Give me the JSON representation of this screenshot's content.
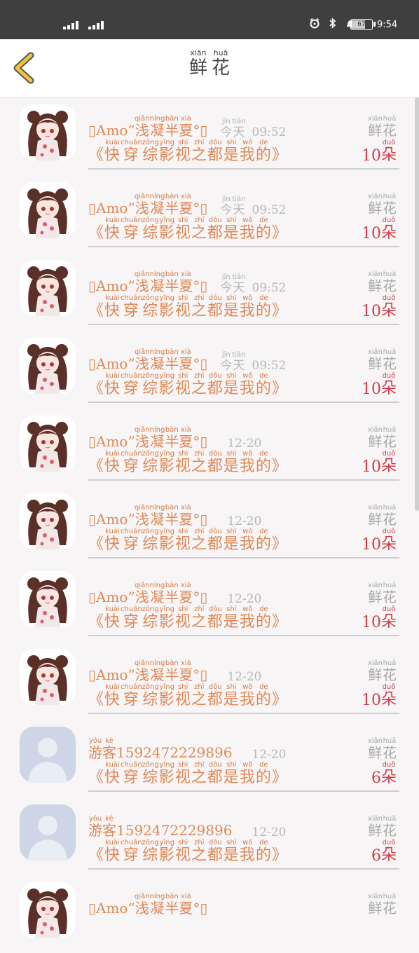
{
  "status_bar": {
    "time": "9:54",
    "battery": "67",
    "battery_level": 0.67
  },
  "header": {
    "title": [
      {
        "char": "鲜",
        "pinyin": "xiān"
      },
      {
        "char": "花",
        "pinyin": "huā"
      }
    ]
  },
  "rows": [
    {
      "avatar": "anime-girl",
      "name_prefix": "Amo",
      "name_mid": "”",
      "name_chars": [
        {
          "c": "浅",
          "p": "qiǎn"
        },
        {
          "c": "凝",
          "p": "níng"
        },
        {
          "c": "半",
          "p": "bàn"
        },
        {
          "c": "夏",
          "p": "xià"
        }
      ],
      "name_suffix": "°",
      "time_chars": [
        {
          "c": "今",
          "p": "jīn"
        },
        {
          "c": "天",
          "p": "tiān"
        }
      ],
      "time": "09:52",
      "book_open": "《",
      "book_chars": [
        {
          "c": "快",
          "p": "kuài"
        },
        {
          "c": "穿",
          "p": "chuān"
        },
        {
          "c": "综",
          "p": "zōng"
        },
        {
          "c": "影",
          "p": "yǐng"
        },
        {
          "c": "视",
          "p": "shì"
        },
        {
          "c": "之",
          "p": "zhī"
        },
        {
          "c": "都",
          "p": "dōu"
        },
        {
          "c": "是",
          "p": "shì"
        },
        {
          "c": "我",
          "p": "wǒ"
        },
        {
          "c": "的",
          "p": "de"
        }
      ],
      "book_close": "》",
      "gift": [
        {
          "c": "鲜",
          "p": "xiān"
        },
        {
          "c": "花",
          "p": "huā"
        }
      ],
      "count": "10",
      "unit": {
        "c": "朵",
        "p": "duǒ"
      }
    },
    {
      "avatar": "anime-girl",
      "name_prefix": "Amo",
      "name_mid": "”",
      "name_chars": [
        {
          "c": "浅",
          "p": "qiǎn"
        },
        {
          "c": "凝",
          "p": "níng"
        },
        {
          "c": "半",
          "p": "bàn"
        },
        {
          "c": "夏",
          "p": "xià"
        }
      ],
      "name_suffix": "°",
      "time_chars": [
        {
          "c": "今",
          "p": "jīn"
        },
        {
          "c": "天",
          "p": "tiān"
        }
      ],
      "time": "09:52",
      "book_open": "《",
      "book_chars": [
        {
          "c": "快",
          "p": "kuài"
        },
        {
          "c": "穿",
          "p": "chuān"
        },
        {
          "c": "综",
          "p": "zōng"
        },
        {
          "c": "影",
          "p": "yǐng"
        },
        {
          "c": "视",
          "p": "shì"
        },
        {
          "c": "之",
          "p": "zhī"
        },
        {
          "c": "都",
          "p": "dōu"
        },
        {
          "c": "是",
          "p": "shì"
        },
        {
          "c": "我",
          "p": "wǒ"
        },
        {
          "c": "的",
          "p": "de"
        }
      ],
      "book_close": "》",
      "gift": [
        {
          "c": "鲜",
          "p": "xiān"
        },
        {
          "c": "花",
          "p": "huā"
        }
      ],
      "count": "10",
      "unit": {
        "c": "朵",
        "p": "duǒ"
      }
    },
    {
      "avatar": "anime-girl",
      "name_prefix": "Amo",
      "name_mid": "”",
      "name_chars": [
        {
          "c": "浅",
          "p": "qiǎn"
        },
        {
          "c": "凝",
          "p": "níng"
        },
        {
          "c": "半",
          "p": "bàn"
        },
        {
          "c": "夏",
          "p": "xià"
        }
      ],
      "name_suffix": "°",
      "time_chars": [
        {
          "c": "今",
          "p": "jīn"
        },
        {
          "c": "天",
          "p": "tiān"
        }
      ],
      "time": "09:52",
      "book_open": "《",
      "book_chars": [
        {
          "c": "快",
          "p": "kuài"
        },
        {
          "c": "穿",
          "p": "chuān"
        },
        {
          "c": "综",
          "p": "zōng"
        },
        {
          "c": "影",
          "p": "yǐng"
        },
        {
          "c": "视",
          "p": "shì"
        },
        {
          "c": "之",
          "p": "zhī"
        },
        {
          "c": "都",
          "p": "dōu"
        },
        {
          "c": "是",
          "p": "shì"
        },
        {
          "c": "我",
          "p": "wǒ"
        },
        {
          "c": "的",
          "p": "de"
        }
      ],
      "book_close": "》",
      "gift": [
        {
          "c": "鲜",
          "p": "xiān"
        },
        {
          "c": "花",
          "p": "huā"
        }
      ],
      "count": "10",
      "unit": {
        "c": "朵",
        "p": "duǒ"
      }
    },
    {
      "avatar": "anime-girl",
      "name_prefix": "Amo",
      "name_mid": "”",
      "name_chars": [
        {
          "c": "浅",
          "p": "qiǎn"
        },
        {
          "c": "凝",
          "p": "níng"
        },
        {
          "c": "半",
          "p": "bàn"
        },
        {
          "c": "夏",
          "p": "xià"
        }
      ],
      "name_suffix": "°",
      "time_chars": [
        {
          "c": "今",
          "p": "jīn"
        },
        {
          "c": "天",
          "p": "tiān"
        }
      ],
      "time": "09:52",
      "book_open": "《",
      "book_chars": [
        {
          "c": "快",
          "p": "kuài"
        },
        {
          "c": "穿",
          "p": "chuān"
        },
        {
          "c": "综",
          "p": "zōng"
        },
        {
          "c": "影",
          "p": "yǐng"
        },
        {
          "c": "视",
          "p": "shì"
        },
        {
          "c": "之",
          "p": "zhī"
        },
        {
          "c": "都",
          "p": "dōu"
        },
        {
          "c": "是",
          "p": "shì"
        },
        {
          "c": "我",
          "p": "wǒ"
        },
        {
          "c": "的",
          "p": "de"
        }
      ],
      "book_close": "》",
      "gift": [
        {
          "c": "鲜",
          "p": "xiān"
        },
        {
          "c": "花",
          "p": "huā"
        }
      ],
      "count": "10",
      "unit": {
        "c": "朵",
        "p": "duǒ"
      }
    },
    {
      "avatar": "anime-girl",
      "name_prefix": "Amo",
      "name_mid": "”",
      "name_chars": [
        {
          "c": "浅",
          "p": "qiǎn"
        },
        {
          "c": "凝",
          "p": "níng"
        },
        {
          "c": "半",
          "p": "bàn"
        },
        {
          "c": "夏",
          "p": "xià"
        }
      ],
      "name_suffix": "°",
      "time_chars": [],
      "time": "12-20",
      "book_open": "《",
      "book_chars": [
        {
          "c": "快",
          "p": "kuài"
        },
        {
          "c": "穿",
          "p": "chuān"
        },
        {
          "c": "综",
          "p": "zōng"
        },
        {
          "c": "影",
          "p": "yǐng"
        },
        {
          "c": "视",
          "p": "shì"
        },
        {
          "c": "之",
          "p": "zhī"
        },
        {
          "c": "都",
          "p": "dōu"
        },
        {
          "c": "是",
          "p": "shì"
        },
        {
          "c": "我",
          "p": "wǒ"
        },
        {
          "c": "的",
          "p": "de"
        }
      ],
      "book_close": "》",
      "gift": [
        {
          "c": "鲜",
          "p": "xiān"
        },
        {
          "c": "花",
          "p": "huā"
        }
      ],
      "count": "10",
      "unit": {
        "c": "朵",
        "p": "duǒ"
      }
    },
    {
      "avatar": "anime-girl",
      "name_prefix": "Amo",
      "name_mid": "”",
      "name_chars": [
        {
          "c": "浅",
          "p": "qiǎn"
        },
        {
          "c": "凝",
          "p": "níng"
        },
        {
          "c": "半",
          "p": "bàn"
        },
        {
          "c": "夏",
          "p": "xià"
        }
      ],
      "name_suffix": "°",
      "time_chars": [],
      "time": "12-20",
      "book_open": "《",
      "book_chars": [
        {
          "c": "快",
          "p": "kuài"
        },
        {
          "c": "穿",
          "p": "chuān"
        },
        {
          "c": "综",
          "p": "zōng"
        },
        {
          "c": "影",
          "p": "yǐng"
        },
        {
          "c": "视",
          "p": "shì"
        },
        {
          "c": "之",
          "p": "zhī"
        },
        {
          "c": "都",
          "p": "dōu"
        },
        {
          "c": "是",
          "p": "shì"
        },
        {
          "c": "我",
          "p": "wǒ"
        },
        {
          "c": "的",
          "p": "de"
        }
      ],
      "book_close": "》",
      "gift": [
        {
          "c": "鲜",
          "p": "xiān"
        },
        {
          "c": "花",
          "p": "huā"
        }
      ],
      "count": "10",
      "unit": {
        "c": "朵",
        "p": "duǒ"
      }
    },
    {
      "avatar": "anime-girl",
      "name_prefix": "Amo",
      "name_mid": "”",
      "name_chars": [
        {
          "c": "浅",
          "p": "qiǎn"
        },
        {
          "c": "凝",
          "p": "níng"
        },
        {
          "c": "半",
          "p": "bàn"
        },
        {
          "c": "夏",
          "p": "xià"
        }
      ],
      "name_suffix": "°",
      "time_chars": [],
      "time": "12-20",
      "book_open": "《",
      "book_chars": [
        {
          "c": "快",
          "p": "kuài"
        },
        {
          "c": "穿",
          "p": "chuān"
        },
        {
          "c": "综",
          "p": "zōng"
        },
        {
          "c": "影",
          "p": "yǐng"
        },
        {
          "c": "视",
          "p": "shì"
        },
        {
          "c": "之",
          "p": "zhī"
        },
        {
          "c": "都",
          "p": "dōu"
        },
        {
          "c": "是",
          "p": "shì"
        },
        {
          "c": "我",
          "p": "wǒ"
        },
        {
          "c": "的",
          "p": "de"
        }
      ],
      "book_close": "》",
      "gift": [
        {
          "c": "鲜",
          "p": "xiān"
        },
        {
          "c": "花",
          "p": "huā"
        }
      ],
      "count": "10",
      "unit": {
        "c": "朵",
        "p": "duǒ"
      }
    },
    {
      "avatar": "anime-girl",
      "name_prefix": "Amo",
      "name_mid": "”",
      "name_chars": [
        {
          "c": "浅",
          "p": "qiǎn"
        },
        {
          "c": "凝",
          "p": "níng"
        },
        {
          "c": "半",
          "p": "bàn"
        },
        {
          "c": "夏",
          "p": "xià"
        }
      ],
      "name_suffix": "°",
      "time_chars": [],
      "time": "12-20",
      "book_open": "《",
      "book_chars": [
        {
          "c": "快",
          "p": "kuài"
        },
        {
          "c": "穿",
          "p": "chuān"
        },
        {
          "c": "综",
          "p": "zōng"
        },
        {
          "c": "影",
          "p": "yǐng"
        },
        {
          "c": "视",
          "p": "shì"
        },
        {
          "c": "之",
          "p": "zhī"
        },
        {
          "c": "都",
          "p": "dōu"
        },
        {
          "c": "是",
          "p": "shì"
        },
        {
          "c": "我",
          "p": "wǒ"
        },
        {
          "c": "的",
          "p": "de"
        }
      ],
      "book_close": "》",
      "gift": [
        {
          "c": "鲜",
          "p": "xiān"
        },
        {
          "c": "花",
          "p": "huā"
        }
      ],
      "count": "10",
      "unit": {
        "c": "朵",
        "p": "duǒ"
      }
    },
    {
      "avatar": "default-user",
      "name_prefix": "",
      "name_mid": "",
      "name_chars": [
        {
          "c": "游",
          "p": "yóu"
        },
        {
          "c": "客",
          "p": "kè"
        }
      ],
      "name_suffix": "15924722298​96",
      "time_chars": [],
      "time": "12-20",
      "book_open": "《",
      "book_chars": [
        {
          "c": "快",
          "p": "kuài"
        },
        {
          "c": "穿",
          "p": "chuān"
        },
        {
          "c": "综",
          "p": "zōng"
        },
        {
          "c": "影",
          "p": "yǐng"
        },
        {
          "c": "视",
          "p": "shì"
        },
        {
          "c": "之",
          "p": "zhī"
        },
        {
          "c": "都",
          "p": "dōu"
        },
        {
          "c": "是",
          "p": "shì"
        },
        {
          "c": "我",
          "p": "wǒ"
        },
        {
          "c": "的",
          "p": "de"
        }
      ],
      "book_close": "》",
      "gift": [
        {
          "c": "鲜",
          "p": "xiān"
        },
        {
          "c": "花",
          "p": "huā"
        }
      ],
      "count": "6",
      "unit": {
        "c": "朵",
        "p": "duǒ"
      }
    },
    {
      "avatar": "default-user",
      "name_prefix": "",
      "name_mid": "",
      "name_chars": [
        {
          "c": "游",
          "p": "yóu"
        },
        {
          "c": "客",
          "p": "kè"
        }
      ],
      "name_suffix": "15924722298​96",
      "time_chars": [],
      "time": "12-20",
      "book_open": "《",
      "book_chars": [
        {
          "c": "快",
          "p": "kuài"
        },
        {
          "c": "穿",
          "p": "chuān"
        },
        {
          "c": "综",
          "p": "zōng"
        },
        {
          "c": "影",
          "p": "yǐng"
        },
        {
          "c": "视",
          "p": "shì"
        },
        {
          "c": "之",
          "p": "zhī"
        },
        {
          "c": "都",
          "p": "dōu"
        },
        {
          "c": "是",
          "p": "shì"
        },
        {
          "c": "我",
          "p": "wǒ"
        },
        {
          "c": "的",
          "p": "de"
        }
      ],
      "book_close": "》",
      "gift": [
        {
          "c": "鲜",
          "p": "xiān"
        },
        {
          "c": "花",
          "p": "huā"
        }
      ],
      "count": "6",
      "unit": {
        "c": "朵",
        "p": "duǒ"
      }
    },
    {
      "avatar": "anime-girl",
      "name_prefix": "Amo",
      "name_mid": "”",
      "name_chars": [
        {
          "c": "浅",
          "p": "qiǎn"
        },
        {
          "c": "凝",
          "p": "níng"
        },
        {
          "c": "半",
          "p": "bàn"
        },
        {
          "c": "夏",
          "p": "xià"
        }
      ],
      "name_suffix": "°",
      "time_chars": [],
      "time": "",
      "book_open": "",
      "book_chars": [],
      "book_close": "",
      "gift": [
        {
          "c": "鲜",
          "p": "xiān"
        },
        {
          "c": "花",
          "p": "huā"
        }
      ],
      "count": "",
      "unit": {
        "c": "",
        "p": ""
      }
    }
  ],
  "colors": {
    "accent": "#e08855",
    "count": "#d03c48",
    "muted": "#a8a8a8",
    "back_arrow": "#f0c53a"
  }
}
